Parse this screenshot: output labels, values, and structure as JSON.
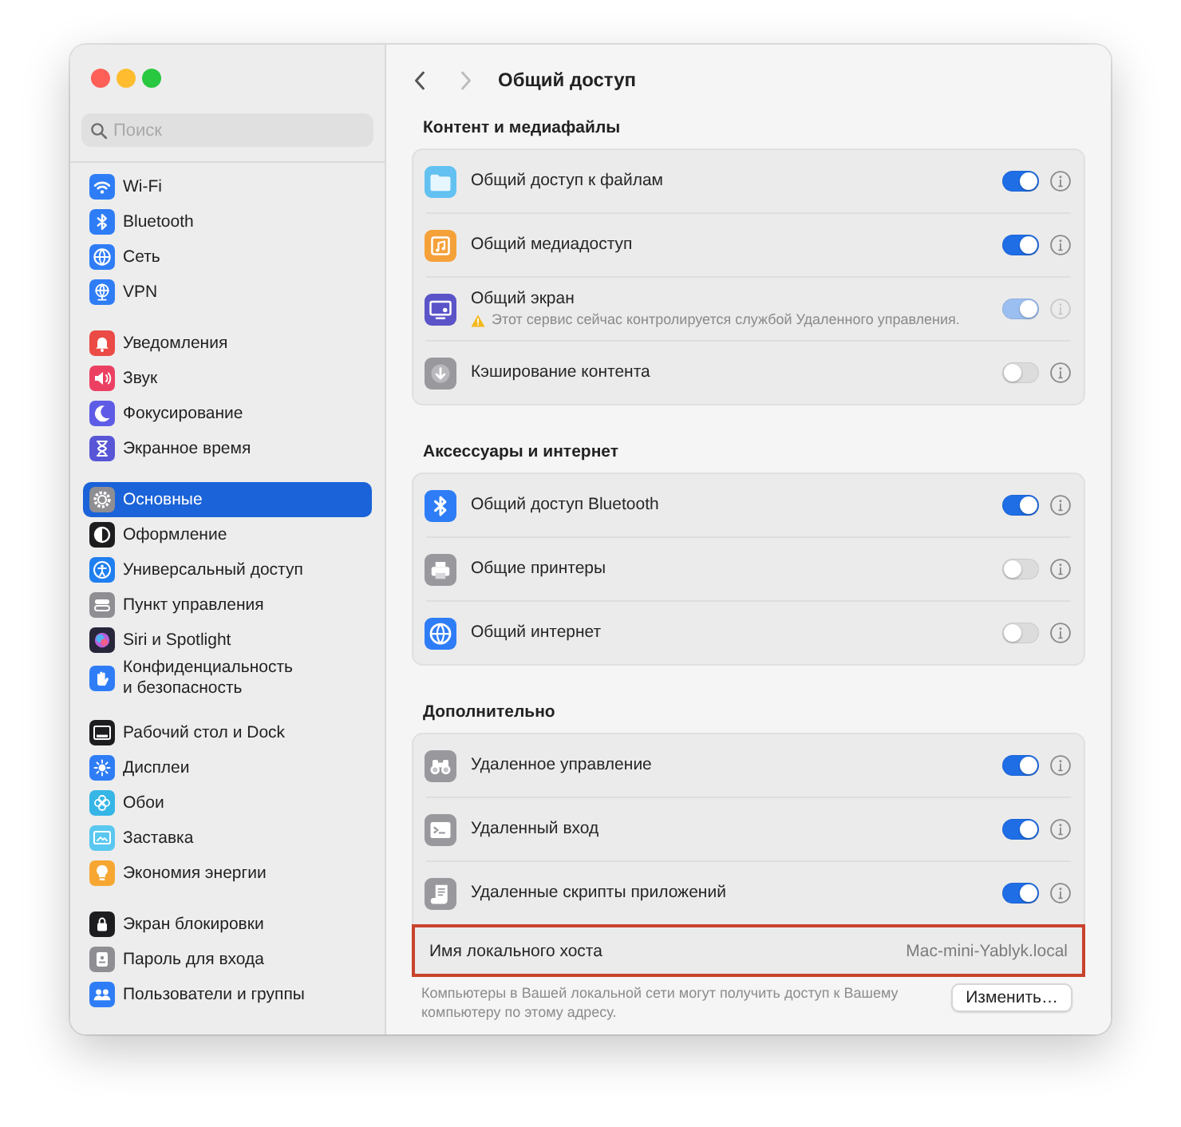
{
  "sidebar": {
    "search": {
      "placeholder": "Поиск"
    },
    "groups": [
      {
        "items": [
          {
            "kind": "wifi",
            "label": "Wi-Fi",
            "selected": false
          },
          {
            "kind": "bluetooth",
            "label": "Bluetooth",
            "selected": false
          },
          {
            "kind": "network",
            "label": "Сеть",
            "selected": false
          },
          {
            "kind": "vpn",
            "label": "VPN",
            "selected": false
          }
        ]
      },
      {
        "items": [
          {
            "kind": "notifications",
            "label": "Уведомления",
            "selected": false
          },
          {
            "kind": "sound",
            "label": "Звук",
            "selected": false
          },
          {
            "kind": "focus",
            "label": "Фокусирование",
            "selected": false
          },
          {
            "kind": "screentime",
            "label": "Экранное время",
            "selected": false
          }
        ]
      },
      {
        "items": [
          {
            "kind": "general",
            "label": "Основные",
            "selected": true
          },
          {
            "kind": "appearance",
            "label": "Оформление",
            "selected": false
          },
          {
            "kind": "accessibility",
            "label": "Универсальный доступ",
            "selected": false
          },
          {
            "kind": "controlcenter",
            "label": "Пункт управления",
            "selected": false
          },
          {
            "kind": "siri",
            "label": "Siri и Spotlight",
            "selected": false
          },
          {
            "kind": "privacy",
            "label": "Конфиденциальность\nи безопасность",
            "selected": false
          }
        ]
      },
      {
        "items": [
          {
            "kind": "desktop",
            "label": "Рабочий стол и Dock",
            "selected": false
          },
          {
            "kind": "displays",
            "label": "Дисплеи",
            "selected": false
          },
          {
            "kind": "wallpaper",
            "label": "Обои",
            "selected": false
          },
          {
            "kind": "screensaver",
            "label": "Заставка",
            "selected": false
          },
          {
            "kind": "energy",
            "label": "Экономия энергии",
            "selected": false
          }
        ]
      },
      {
        "items": [
          {
            "kind": "lockscreen",
            "label": "Экран блокировки",
            "selected": false
          },
          {
            "kind": "password",
            "label": "Пароль для входа",
            "selected": false
          },
          {
            "kind": "users",
            "label": "Пользователи и группы",
            "selected": false
          }
        ]
      }
    ]
  },
  "toolbar": {
    "nav": [
      {
        "kind": "back",
        "disabled": false
      },
      {
        "kind": "forward",
        "disabled": true
      }
    ],
    "title": "Общий доступ"
  },
  "sections": [
    {
      "title": "Контент и медиафайлы",
      "rows": [
        {
          "kind": "files",
          "label": "Общий доступ к файлам",
          "on": true,
          "disabled": false
        },
        {
          "kind": "media",
          "label": "Общий медиадоступ",
          "on": true,
          "disabled": false
        },
        {
          "kind": "screen",
          "label": "Общий экран",
          "note": "Этот сервис сейчас контролируется службой Удаленного управления.",
          "on": true,
          "disabled": true
        },
        {
          "kind": "cache",
          "label": "Кэширование контента",
          "on": false,
          "disabled": false
        }
      ]
    },
    {
      "title": "Аксессуары и интернет",
      "rows": [
        {
          "kind": "bluetooth",
          "label": "Общий доступ Bluetooth",
          "on": true,
          "disabled": false
        },
        {
          "kind": "printers",
          "label": "Общие принтеры",
          "on": false,
          "disabled": false
        },
        {
          "kind": "internet",
          "label": "Общий интернет",
          "on": false,
          "disabled": false
        }
      ]
    },
    {
      "title": "Дополнительно",
      "rows": [
        {
          "kind": "remote-management",
          "label": "Удаленное управление",
          "on": true,
          "disabled": false
        },
        {
          "kind": "remote-login",
          "label": "Удаленный вход",
          "on": true,
          "disabled": false
        },
        {
          "kind": "scripts",
          "label": "Удаленные скрипты приложений",
          "on": true,
          "disabled": false
        }
      ],
      "hostname": {
        "label": "Имя локального хоста",
        "value": "Mac-mini-Yablyk.local",
        "highlighted": true
      },
      "description": "Компьютеры в Вашей локальной сети могут получить доступ к Вашему компьютеру по этому адресу.",
      "button": "Изменить…"
    }
  ]
}
